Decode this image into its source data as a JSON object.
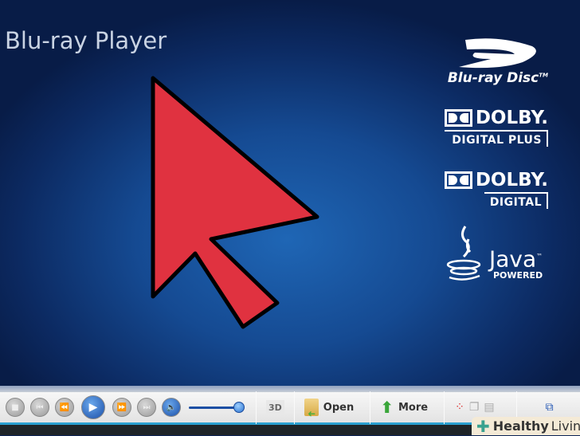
{
  "app": {
    "title": "Blu-ray Player"
  },
  "logos": {
    "bluray": "Blu-ray Disc",
    "bluray_tm": "TM",
    "dolby1": {
      "brand": "DOLBY.",
      "sub": "DIGITAL PLUS"
    },
    "dolby2": {
      "brand": "DOLBY.",
      "sub": "DIGITAL"
    },
    "java": {
      "brand": "Java",
      "tm": "™",
      "sub": "POWERED"
    }
  },
  "controls": {
    "volume_percent": 100,
    "three_d": "3D",
    "open": "Open",
    "more": "More"
  },
  "watermark": {
    "brand1": "Healthy",
    "brand2": "Living"
  },
  "colors": {
    "cursor": "#e03240",
    "accent": "#2a9fd0"
  }
}
